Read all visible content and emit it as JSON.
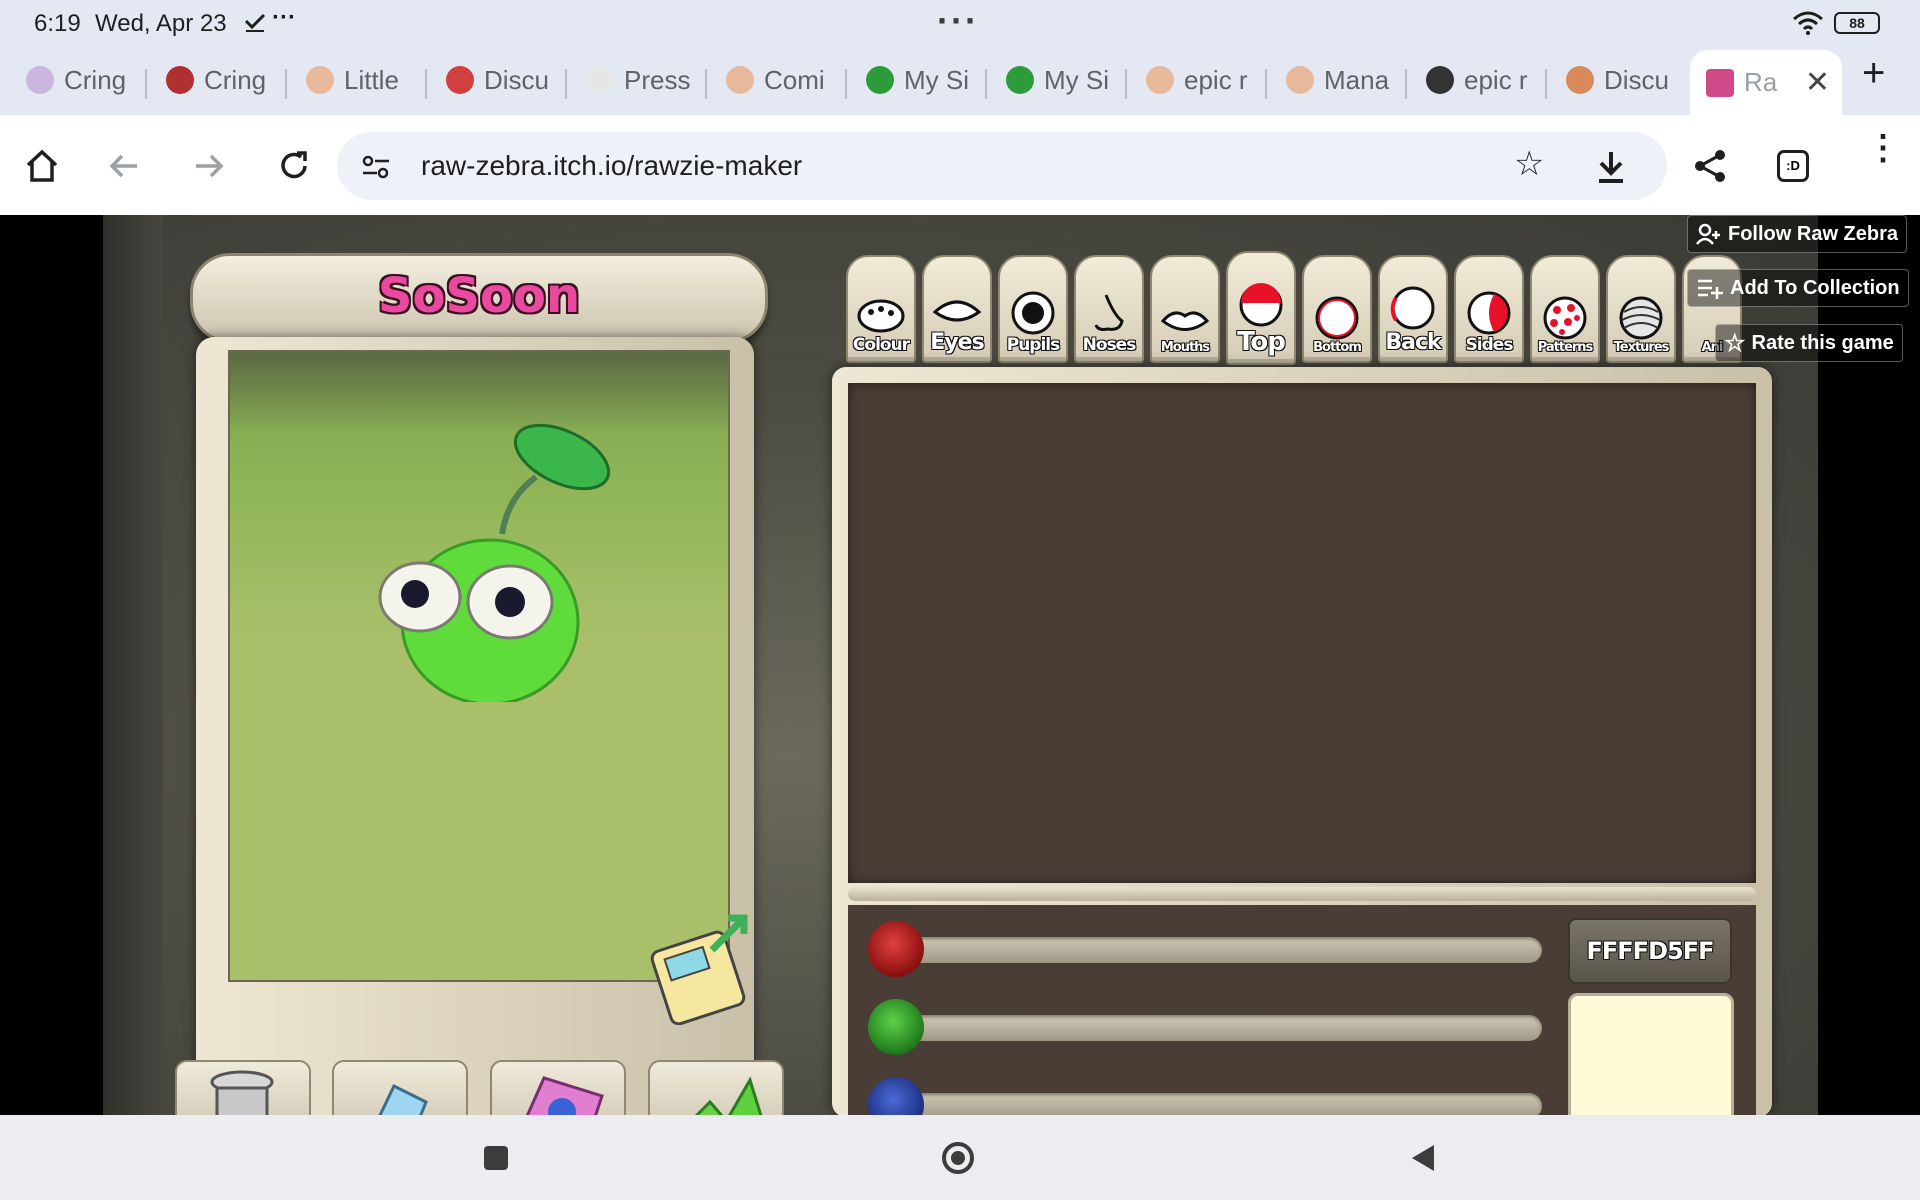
{
  "status": {
    "time": "6:19",
    "date": "Wed, Apr 23",
    "battery": "88"
  },
  "tabs": [
    {
      "label": "Cring",
      "favicon_color": "#cbb7e0"
    },
    {
      "label": "Cring",
      "favicon_color": "#b03030"
    },
    {
      "label": "Little",
      "favicon_color": "#e8b89a"
    },
    {
      "label": "Discu",
      "favicon_color": "#d04040"
    },
    {
      "label": "Press",
      "favicon_color": "#e6e6e6"
    },
    {
      "label": "Comi",
      "favicon_color": "#e8b89a"
    },
    {
      "label": "My Si",
      "favicon_color": "#2e9b3a"
    },
    {
      "label": "My Si",
      "favicon_color": "#2e9b3a"
    },
    {
      "label": "epic r",
      "favicon_color": "#e8b89a"
    },
    {
      "label": "Mana",
      "favicon_color": "#e8b89a"
    },
    {
      "label": "epic r",
      "favicon_color": "#333333"
    },
    {
      "label": "Discu",
      "favicon_color": "#d88a5a"
    }
  ],
  "active_tab": {
    "label": "Ra",
    "favicon_color": "#d04a8a"
  },
  "address_bar": {
    "url": "raw-zebra.itch.io/rawzie-maker"
  },
  "itch": {
    "follow": "Follow Raw Zebra",
    "collection": "Add To Collection",
    "rate": "Rate this game"
  },
  "game": {
    "creature_name": "SoSoon",
    "categories": [
      "Colour",
      "Eyes",
      "Pupils",
      "Noses",
      "Mouths",
      "Top",
      "Bottom",
      "Back",
      "Sides",
      "Patterns",
      "Textures",
      "Ani"
    ],
    "active_category": "Top",
    "hex_value": "FFFFD5FF",
    "colors": {
      "creature": "#5fdc3c",
      "preview_bg": "#a9bf6a",
      "panel": "#4a3d36",
      "name_text": "#e94aa0",
      "swatch": "#fffbd9"
    }
  }
}
